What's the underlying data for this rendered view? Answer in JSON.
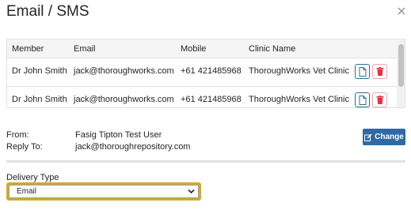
{
  "modal": {
    "title": "Email / SMS",
    "close_icon": "close-icon"
  },
  "recipients": {
    "columns": [
      "Member",
      "Email",
      "Mobile",
      "Clinic Name"
    ],
    "rows": [
      {
        "member": "Dr John Smith",
        "email": "jack@thoroughworks.com",
        "mobile": "+61 421485968",
        "clinic": "ThoroughWorks Vet Clinic"
      },
      {
        "member": "Dr John Smith",
        "email": "jack@thoroughworks.com",
        "mobile": "+61 421485968",
        "clinic": "ThoroughWorks Vet Clinic"
      }
    ],
    "row_actions": [
      "document-icon",
      "trash-icon"
    ]
  },
  "sender": {
    "from_label": "From:",
    "from_value": "Fasig Tipton Test User",
    "reply_label": "Reply To:",
    "reply_value": "jack@thoroughrepository.com",
    "change_label": "Change",
    "change_icon": "edit-icon"
  },
  "delivery": {
    "label": "Delivery Type",
    "selected": "Email"
  },
  "colors": {
    "primary": "#2f6aa3",
    "danger": "#dc3545",
    "focus": "#d4a82a",
    "doc_icon": "#2c6e8f"
  }
}
